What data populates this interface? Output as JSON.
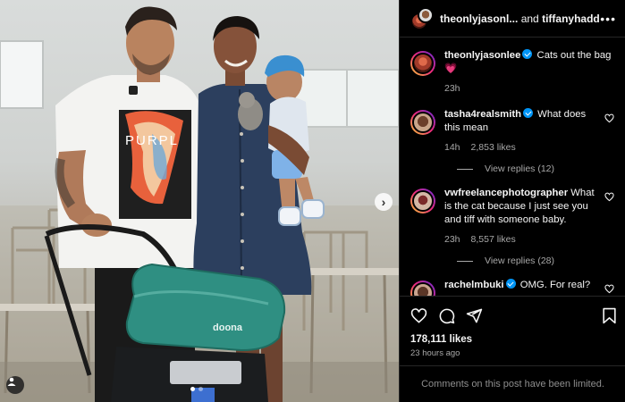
{
  "post": {
    "header_user_1": "theonlyjasonl...",
    "header_and": "and",
    "header_user_2": "tiffanyhadd...",
    "caption_user": "theonlyjasonlee",
    "caption_text": "Cats out the bag",
    "caption_emoji": "💗",
    "caption_time": "23h",
    "likes": "178,111 likes",
    "posted": "23 hours ago",
    "comments_limited": "Comments on this post have been limited.",
    "carousel_slides": 2,
    "carousel_active": 1
  },
  "comments": [
    {
      "user": "tasha4realsmith",
      "verified": true,
      "text": "What does this mean",
      "time": "14h",
      "likes": "2,853 likes",
      "replies": "View replies (12)"
    },
    {
      "user": "vwfreelancephotographer",
      "verified": false,
      "text": "What is the cat because I just see you and tiff with someone baby.",
      "time": "23h",
      "likes": "8,557 likes",
      "replies": "View replies (28)"
    },
    {
      "user": "rachelmbuki",
      "verified": true,
      "text": "OMG. For real?"
    }
  ],
  "photo": {
    "shirt_text": "PURPL",
    "brand_text": "doona"
  },
  "colors": {
    "verified_blue": "#0095f6",
    "secondary_text": "#a8a8a8",
    "stroller_teal": "#2f8f82"
  },
  "icons": [
    "more-icon",
    "heart-icon",
    "comment-icon",
    "share-icon",
    "bookmark-icon",
    "chevron-right-icon",
    "user-tag-icon"
  ]
}
